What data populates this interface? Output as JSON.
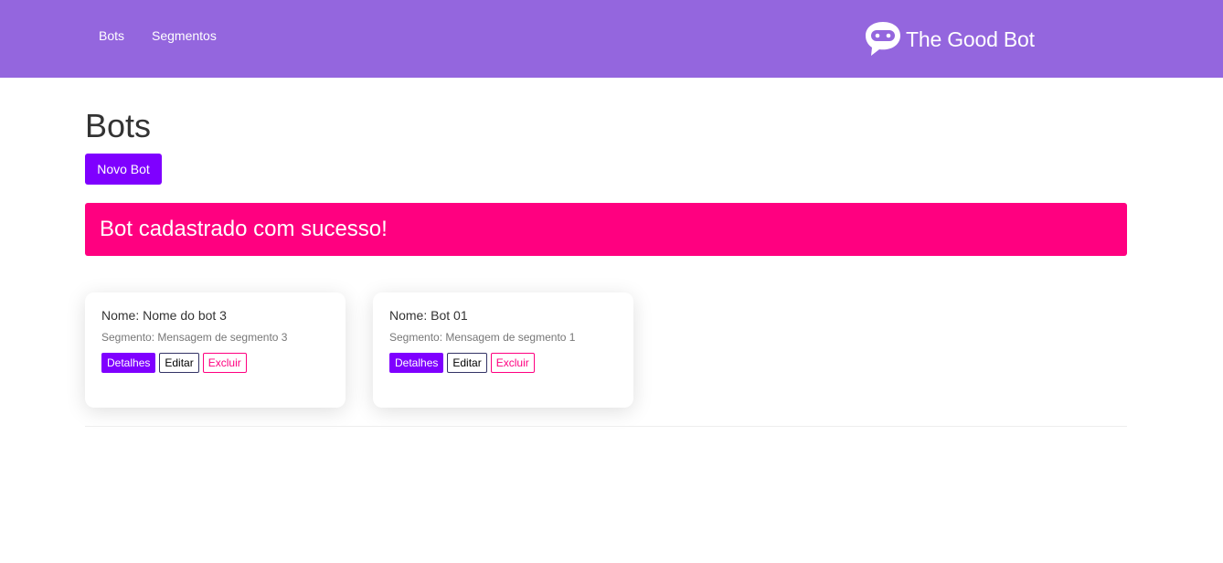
{
  "colors": {
    "navbar_bg": "#9466de",
    "primary": "#7f00ff",
    "alert_bg": "#ff0080",
    "danger": "#ff0080"
  },
  "nav": {
    "items": [
      {
        "label": "Bots"
      },
      {
        "label": "Segmentos"
      }
    ],
    "brand": {
      "icon": "chat-bot-icon",
      "text": "The Good Bot"
    }
  },
  "page": {
    "title": "Bots",
    "new_button_label": "Novo Bot"
  },
  "alert": {
    "message": "Bot cadastrado com sucesso!"
  },
  "bots": [
    {
      "name": "Nome: Nome do bot 3",
      "segment": "Segmento: Mensagem de segmento 3",
      "actions": {
        "details": "Detalhes",
        "edit": "Editar",
        "delete": "Excluir"
      }
    },
    {
      "name": "Nome: Bot 01",
      "segment": "Segmento: Mensagem de segmento 1",
      "actions": {
        "details": "Detalhes",
        "edit": "Editar",
        "delete": "Excluir"
      }
    }
  ]
}
